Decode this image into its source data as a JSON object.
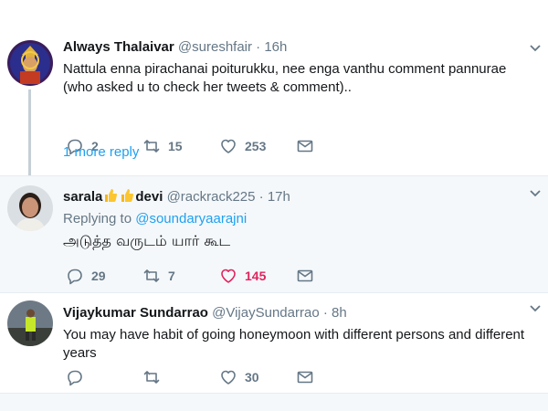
{
  "tweets": [
    {
      "name": "Always Thalaivar",
      "handle": "@sureshfair",
      "separator": "·",
      "time": "16h",
      "text": "Nattula enna pirachanai poiturukku, nee enga vanthu comment pannurae (who asked u to check her tweets & comment)..",
      "replies": "2",
      "retweets": "15",
      "likes": "253",
      "more_replies": "1 more reply"
    },
    {
      "name_part1": "sarala",
      "name_part2": "devi",
      "handle": "@rackrack225",
      "separator": "·",
      "time": "17h",
      "replying_label": "Replying to",
      "replying_handle": "@soundaryaarajni",
      "text": "அடுத்த வருடம் யார் கூட",
      "replies": "29",
      "retweets": "7",
      "likes": "145"
    },
    {
      "name": "Vijaykumar Sundarrao",
      "handle": "@VijaySundarrao",
      "separator": "·",
      "time": "8h",
      "text": "You may have habit of going honeymoon with different persons and different years",
      "likes": "30"
    }
  ],
  "colors": {
    "text": "#14171a",
    "muted": "#657786",
    "link": "#1da1f2",
    "like_active": "#e0245e",
    "thread_line": "#c4cfd6",
    "highlight_bg": "#f5f8fa"
  },
  "icons": [
    "reply-icon",
    "retweet-icon",
    "like-icon",
    "dm-icon",
    "chevron-down-icon",
    "thumbs-up-emoji"
  ]
}
